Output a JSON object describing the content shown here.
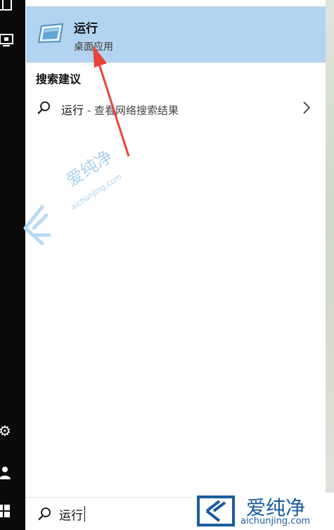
{
  "best_match": {
    "title": "运行",
    "subtitle": "桌面应用",
    "icon": "run-dialog-icon"
  },
  "suggestions": {
    "section_title": "搜索建议",
    "items": [
      {
        "query": "运行",
        "tail": " - 查看网络搜索结果",
        "icon": "search-icon"
      }
    ]
  },
  "search": {
    "value": "运行"
  },
  "rail_icons": [
    "menu-icon",
    "monitor-icon",
    "gear-icon",
    "people-icon",
    "windows-icon"
  ],
  "watermark": {
    "name": "爱纯净",
    "domain": "aichunjing.com"
  },
  "colors": {
    "highlight": "#b3d4f0",
    "rail": "#0b0b0b",
    "arrow": "#e8433a",
    "watermark": "#1a5c9e"
  }
}
